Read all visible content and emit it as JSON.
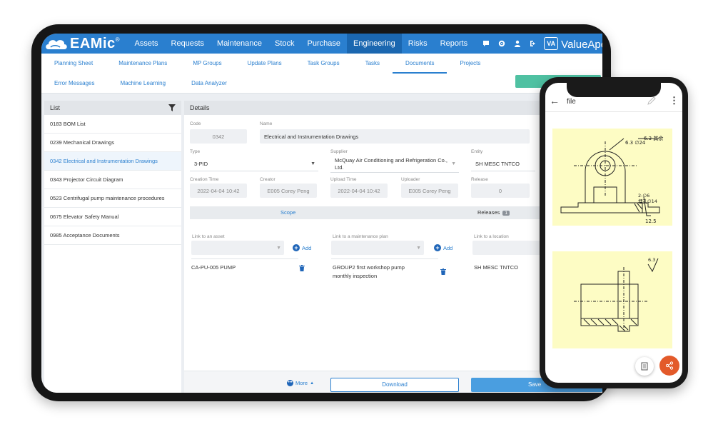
{
  "brand": {
    "name": "EAMic",
    "reg": "®",
    "partner": "ValueApex 领值",
    "partner_mark": "VA"
  },
  "topnav": [
    {
      "label": "Assets"
    },
    {
      "label": "Requests"
    },
    {
      "label": "Maintenance"
    },
    {
      "label": "Stock"
    },
    {
      "label": "Purchase"
    },
    {
      "label": "Engineering",
      "active": true
    },
    {
      "label": "Risks"
    },
    {
      "label": "Reports"
    }
  ],
  "subnav_row1": [
    "Planning Sheet",
    "Maintenance Plans",
    "MP Groups",
    "Update Plans",
    "Task Groups",
    "Tasks",
    "Documents",
    "Projects"
  ],
  "subnav_row2": [
    "Error Messages",
    "Machine Learning",
    "Data Analyzer"
  ],
  "list": {
    "title": "List",
    "items": [
      "0183 BOM List",
      "0239 Mechanical Drawings",
      "0342 Electrical and Instrumentation Drawings",
      "0343 Projector Circuit Diagram",
      "0523 Centrifugal pump maintenance procedures",
      "0675 Elevator Safety Manual",
      "0985 Acceptance Documents"
    ],
    "selected_index": 2
  },
  "details": {
    "title": "Details",
    "code_label": "Code",
    "code": "0342",
    "name_label": "Name",
    "name": "Electrical and Instrumentation Drawings",
    "type_label": "Type",
    "type": "3-PID",
    "supplier_label": "Supplier",
    "supplier": "McQuay Air Conditioning and Refrigeration Co., Ltd.",
    "entity_label": "Entity",
    "entity": "SH MESC TNTCO",
    "creation_time_label": "Creation Time",
    "creation_time": "2022-04-04 10:42",
    "creator_label": "Creator",
    "creator": "E005 Corey Peng",
    "upload_time_label": "Upload Time",
    "upload_time": "2022-04-04 10:42",
    "uploader_label": "Uploader",
    "uploader": "E005 Corey Peng",
    "release_label": "Release",
    "release": "0",
    "tab_scope": "Scope",
    "tab_releases": "Releases",
    "releases_count": "1",
    "link_asset_label": "Link to an asset",
    "link_plan_label": "Link to a maintenance plan",
    "link_location_label": "Link to a location",
    "add_label": "Add",
    "asset_value": "CA-PU-005 PUMP",
    "plan_value": "GROUP2 first workshop pump monthly inspection",
    "location_value": "SH MESC TNTCO",
    "more_label": "More",
    "download_label": "Download",
    "save_label": "Save"
  },
  "phone": {
    "title": "file"
  },
  "colors": {
    "primary": "#2a7fcf",
    "nav_active": "#1b67b0",
    "accent_green": "#4fc1a2",
    "share_fab": "#e35a2a",
    "drawing_bg": "#fdfcc4"
  }
}
